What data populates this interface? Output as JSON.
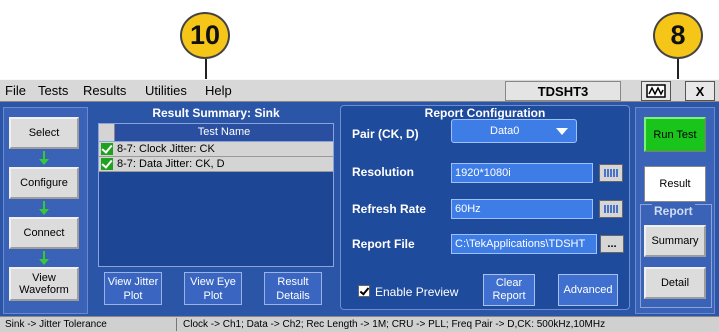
{
  "callouts": {
    "left": "10",
    "right": "8"
  },
  "menubar": {
    "items": [
      "File",
      "Tests",
      "Results",
      "Utilities",
      "Help"
    ],
    "app_name": "TDSHT3",
    "close_glyph": "X"
  },
  "nav": {
    "buttons": [
      "Select",
      "Configure",
      "Connect",
      "View Waveform"
    ],
    "accent": "#35c935"
  },
  "result_summary": {
    "title": "Result Summary: Sink",
    "column_header": "Test Name",
    "rows": [
      {
        "checked": true,
        "name": "8-7: Clock Jitter: CK"
      },
      {
        "checked": true,
        "name": "8-7: Data Jitter: CK, D"
      }
    ],
    "buttons": [
      "View Jitter Plot",
      "View Eye Plot",
      "Result Details"
    ]
  },
  "report_config": {
    "title": "Report Configuration",
    "pair_label": "Pair (CK, D)",
    "pair_value": "Data0",
    "resolution_label": "Resolution",
    "resolution_value": "1920*1080i",
    "refresh_label": "Refresh Rate",
    "refresh_value": "60Hz",
    "file_label": "Report File",
    "file_value": "C:\\TekApplications\\TDSHT",
    "browse_label": "...",
    "enable_preview_label": "Enable Preview",
    "enable_preview_checked": true,
    "clear_report_label": "Clear Report",
    "advanced_label": "Advanced"
  },
  "right_panel": {
    "run_test_label": "Run Test",
    "run_color": "#19c41b",
    "result_label": "Result",
    "report_group_label": "Report",
    "summary_label": "Summary",
    "detail_label": "Detail"
  },
  "status": {
    "left": "Sink -> Jitter Tolerance",
    "right": "Clock -> Ch1; Data -> Ch2; Rec Length -> 1M; CRU -> PLL; Freq Pair -> D,CK: 500kHz,10MHz"
  }
}
